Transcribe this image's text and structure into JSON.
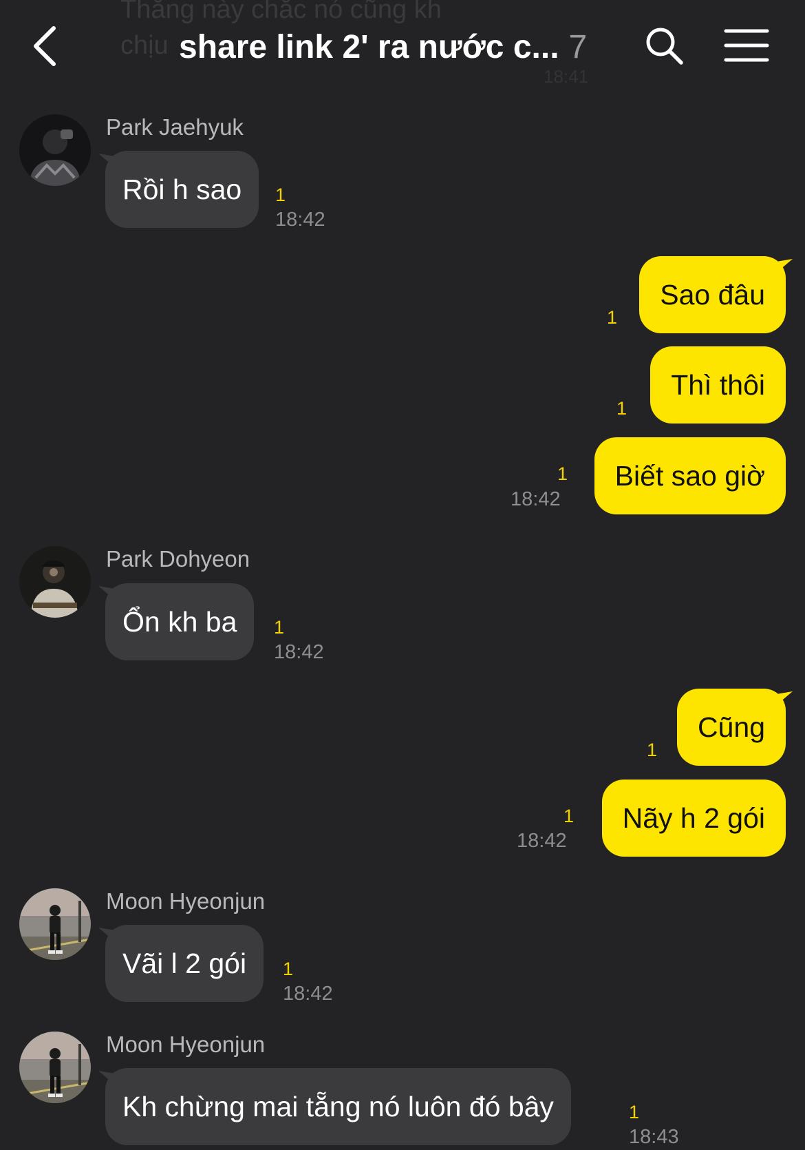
{
  "header": {
    "ghost_preview_text": "Thằng này chắc nó cũng kh\nchịu",
    "ghost_preview_time": "18:41",
    "title": "share link 2' ra nước c...",
    "member_count": "7",
    "icons": {
      "back": "chevron-left-icon",
      "search": "search-icon",
      "menu": "hamburger-menu-icon"
    }
  },
  "colors": {
    "background": "#232325",
    "incoming_bubble": "#3b3b3e",
    "outgoing_bubble": "#fee500",
    "unread_count": "#f2d100",
    "timestamp": "#8e8e92"
  },
  "messages": [
    {
      "direction": "in",
      "sender": "Park Jaehyuk",
      "text": "Rồi h sao",
      "unread": "1",
      "time": "18:42"
    },
    {
      "direction": "out",
      "text": "Sao đâu",
      "unread": "1"
    },
    {
      "direction": "out",
      "text": "Thì thôi",
      "unread": "1"
    },
    {
      "direction": "out",
      "text": "Biết sao giờ",
      "unread": "1",
      "time": "18:42"
    },
    {
      "direction": "in",
      "sender": "Park Dohyeon",
      "text": "Ổn kh ba",
      "unread": "1",
      "time": "18:42"
    },
    {
      "direction": "out",
      "text": "Cũng",
      "unread": "1"
    },
    {
      "direction": "out",
      "text": "Nãy h 2 gói",
      "unread": "1",
      "time": "18:42"
    },
    {
      "direction": "in",
      "sender": "Moon Hyeonjun",
      "text": "Vãi l 2 gói",
      "unread": "1",
      "time": "18:42"
    },
    {
      "direction": "in",
      "sender": "Moon Hyeonjun",
      "text": "Kh chừng mai tẵng nó luôn đó bây",
      "unread": "1",
      "time": "18:43"
    }
  ]
}
